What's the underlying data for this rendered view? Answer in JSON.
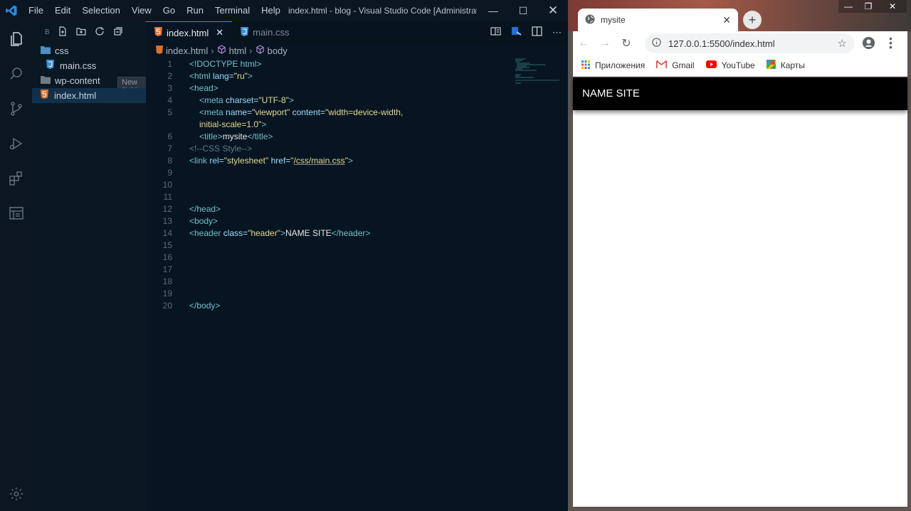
{
  "vscode": {
    "menu": [
      "File",
      "Edit",
      "Selection",
      "View",
      "Go",
      "Run",
      "Terminal",
      "Help"
    ],
    "window_title": "index.html - blog - Visual Studio Code [Administrat...",
    "sidebar": {
      "section_initial": "B",
      "tooltip": "New Folder",
      "items": [
        {
          "label": "css",
          "type": "folder"
        },
        {
          "label": "main.css",
          "type": "css-file"
        },
        {
          "label": "wp-content",
          "type": "folder"
        },
        {
          "label": "index.html",
          "type": "html-file",
          "selected": true
        }
      ]
    },
    "tabs": [
      {
        "label": "index.html",
        "active": true
      },
      {
        "label": "main.css",
        "active": false
      }
    ],
    "breadcrumb": [
      "index.html",
      "html",
      "body"
    ],
    "line_numbers": [
      "1",
      "2",
      "3",
      "4",
      "5",
      "",
      "6",
      "7",
      "8",
      "9",
      "10",
      "11",
      "12",
      "13",
      "14",
      "15",
      "16",
      "17",
      "18",
      "19",
      "20"
    ],
    "code": {
      "l1": "<!DOCTYPE html>",
      "l2_open": "<html ",
      "l2_attr": "lang=",
      "l2_str": "\"ru\"",
      "l2_close": ">",
      "l3": "<head>",
      "l4_open": "<meta ",
      "l4_attr": "charset=",
      "l4_str": "\"UTF-8\"",
      "l4_close": ">",
      "l5_open": "<meta ",
      "l5_attr1": "name=",
      "l5_str1": "\"viewport\"",
      "l5_attr2": " content=",
      "l5_str2": "\"width=device-width,",
      "l5b_str": "initial-scale=1.0\"",
      "l5b_close": ">",
      "l6_open": "<title>",
      "l6_text": "mysite",
      "l6_close": "</title>",
      "l7": "<!--CSS Style-->",
      "l8_open": "<link ",
      "l8_attr1": "rel=",
      "l8_str1": "\"stylesheet\"",
      "l8_attr2": " href=",
      "l8_q1": "\"",
      "l8_link": "/css/main.css",
      "l8_q2": "\"",
      "l8_close": ">",
      "l12": "</head>",
      "l13": "<body>",
      "l14_open": "<header ",
      "l14_attr": "class=",
      "l14_str": "\"header\"",
      "l14_gt": ">",
      "l14_text": "NAME SITE",
      "l14_close": "</header>",
      "l20": "</body>"
    }
  },
  "chrome": {
    "tab_title": "mysite",
    "url": "127.0.0.1:5500/index.html",
    "bookmarks": [
      "Приложения",
      "Gmail",
      "YouTube",
      "Карты"
    ],
    "page_header": "NAME SITE"
  },
  "colors": {
    "vscode_bg": "#061521",
    "accent": "#1e90ff",
    "site_header_bg": "#000000"
  }
}
